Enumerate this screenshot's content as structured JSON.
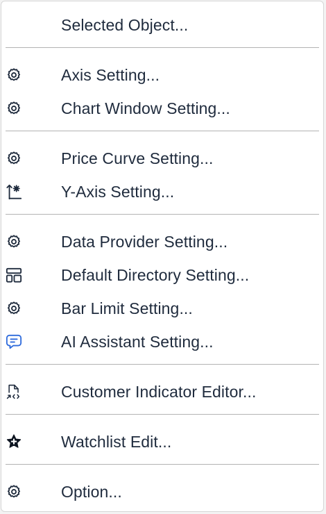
{
  "menu": {
    "items": [
      {
        "label": "Selected Object...",
        "icon": ""
      },
      {
        "label": "Axis Setting...",
        "icon": "gear-icon"
      },
      {
        "label": "Chart Window Setting...",
        "icon": "gear-icon"
      },
      {
        "label": "Price Curve Setting...",
        "icon": "gear-icon"
      },
      {
        "label": "Y-Axis Setting...",
        "icon": "axis-gear-icon"
      },
      {
        "label": "Data Provider Setting...",
        "icon": "gear-icon"
      },
      {
        "label": "Default Directory Setting...",
        "icon": "layout-icon"
      },
      {
        "label": "Bar Limit Setting...",
        "icon": "gear-icon"
      },
      {
        "label": "AI Assistant Setting...",
        "icon": "chat-bubble-icon"
      },
      {
        "label": "Customer Indicator Editor...",
        "icon": "code-file-icon"
      },
      {
        "label": "Watchlist Edit...",
        "icon": "star-plus-icon"
      },
      {
        "label": "Option...",
        "icon": "gear-icon"
      }
    ]
  },
  "colors": {
    "text": "#1f2b3d",
    "separator": "#b3b3b3",
    "ai_icon": "#2f6bdc"
  }
}
